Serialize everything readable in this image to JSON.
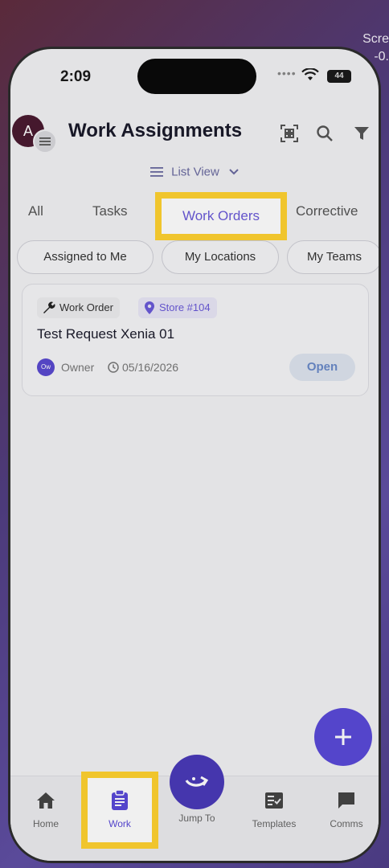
{
  "background": {
    "text_line1": "Scre",
    "text_line2": "-0."
  },
  "status_bar": {
    "time": "2:09",
    "battery": "44"
  },
  "header": {
    "avatar_letter": "A",
    "title": "Work Assignments"
  },
  "view_toggle": {
    "label": "List View"
  },
  "tabs": [
    {
      "label": "All"
    },
    {
      "label": "Tasks"
    },
    {
      "label": "Work Orders"
    },
    {
      "label": "Corrective"
    }
  ],
  "filters": [
    {
      "label": "Assigned to Me"
    },
    {
      "label": "My Locations"
    },
    {
      "label": "My Teams"
    }
  ],
  "card": {
    "type_badge": "Work Order",
    "location_badge": "Store #104",
    "title": "Test Request Xenia 01",
    "owner_initials": "Ow",
    "owner_label": "Owner",
    "date": "05/16/2026",
    "status": "Open"
  },
  "bottom_nav": {
    "home": "Home",
    "work": "Work",
    "jump_to": "Jump To",
    "templates": "Templates",
    "comms": "Comms"
  },
  "colors": {
    "accent": "#5a4ad8",
    "highlight": "#ffd230"
  }
}
